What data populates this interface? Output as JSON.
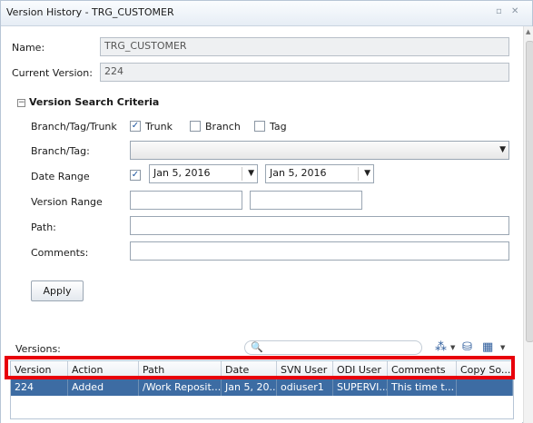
{
  "window": {
    "title": "Version History - TRG_CUSTOMER",
    "restore_glyph": "▫",
    "close_glyph": "✕"
  },
  "form": {
    "name_label": "Name:",
    "name_value": "TRG_CUSTOMER",
    "current_version_label": "Current Version:",
    "current_version_value": "224"
  },
  "criteria": {
    "section_title": "Version Search Criteria",
    "collapse_glyph": "−",
    "branch_tag_trunk_label": "Branch/Tag/Trunk",
    "trunk": {
      "label": "Trunk",
      "checked": true
    },
    "branch": {
      "label": "Branch",
      "checked": false
    },
    "tag": {
      "label": "Tag",
      "checked": false
    },
    "branch_tag_label": "Branch/Tag:",
    "branch_tag_value": "",
    "date_range_label": "Date Range",
    "date_range_enabled": true,
    "date_from": "Jan 5, 2016",
    "date_to": "Jan 5, 2016",
    "version_range_label": "Version Range",
    "version_from": "",
    "version_to": "",
    "path_label": "Path:",
    "path_value": "",
    "comments_label": "Comments:",
    "comments_value": "",
    "apply_label": "Apply",
    "check_glyph": "✓",
    "dropdown_glyph": "▼"
  },
  "versions": {
    "label": "Versions:",
    "search_placeholder": "",
    "search_glyph": "🔍",
    "toolbar_icons": [
      "tree-icon",
      "export-icon",
      "columns-icon"
    ],
    "toolbar_glyphs": {
      "tree": "⁂",
      "export": "⛁",
      "columns": "▦",
      "caret": "▼"
    },
    "columns": [
      "Version",
      "Action",
      "Path",
      "Date",
      "SVN User",
      "ODI User",
      "Comments",
      "Copy So..."
    ],
    "rows": [
      [
        "224",
        "Added",
        "/Work Reposit...",
        "Jan 5, 20...",
        "odiuser1",
        "SUPERVI...",
        "This time t...",
        ""
      ]
    ]
  },
  "colors": {
    "highlight": "#e8000b",
    "selected_row": "#3d6ca3",
    "accent": "#1e56a0"
  }
}
